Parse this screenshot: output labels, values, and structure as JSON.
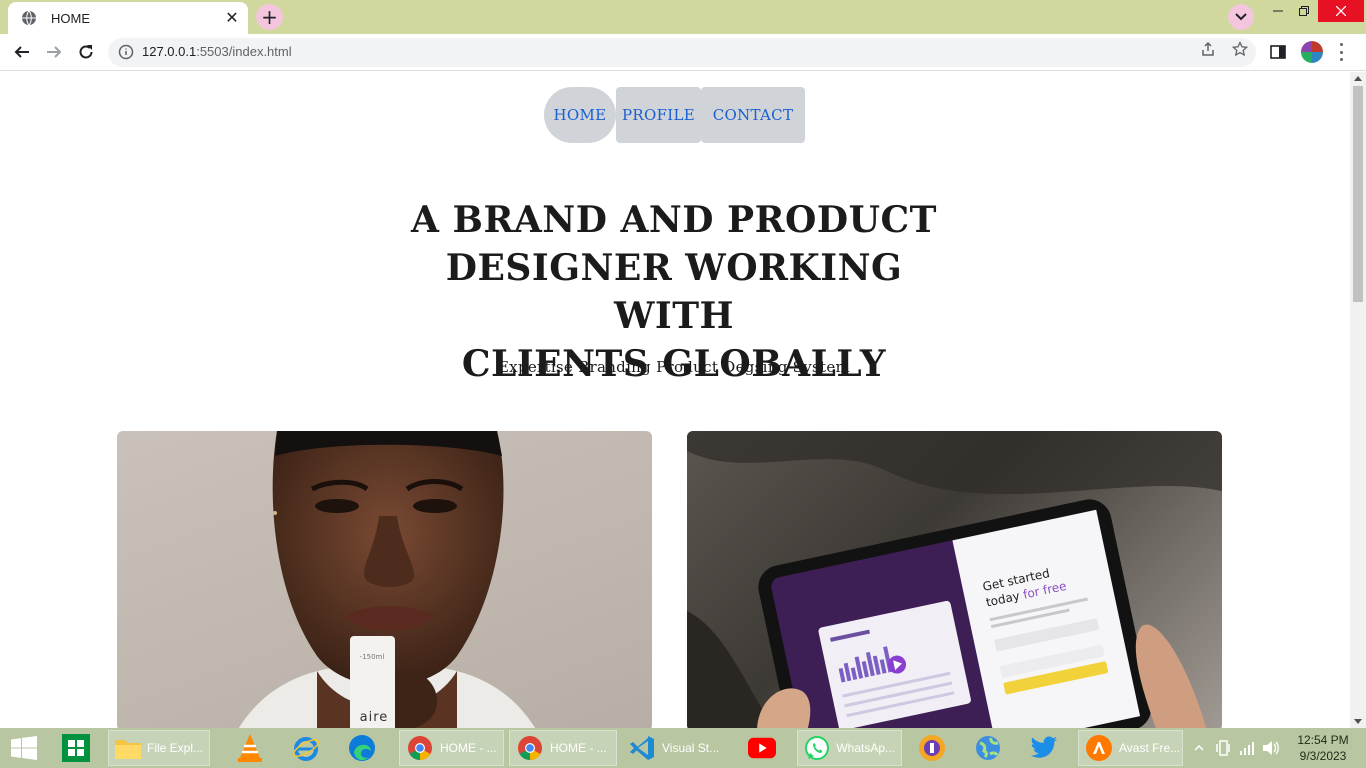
{
  "browser": {
    "tab_title": "HOME",
    "url_host": "127.0.0.1",
    "url_rest": ":5503/index.html"
  },
  "nav": {
    "home": "HOME",
    "profile": "PROFILE",
    "contact": "CONTACT",
    "link_color": "#1a5fd0",
    "bg_color": "#d0d4d9"
  },
  "hero": {
    "title_line1": "A BRAND AND PRODUCT",
    "title_line2": "DESIGNER WORKING WITH",
    "title_line3": "CLIENTS GLOBALLY",
    "subtitle": "Expertise Branding Product Degsing System"
  },
  "cards": [
    {
      "name": "portrait-photo",
      "icon": "photo-man-holding-product"
    },
    {
      "name": "tablet-photo",
      "icon": "photo-hands-holding-tablet"
    }
  ],
  "taskbar": {
    "items": [
      {
        "label": "File Expl...",
        "icon": "folder-icon"
      },
      {
        "label": "HOME - ...",
        "icon": "chrome-icon"
      },
      {
        "label": "HOME - ...",
        "icon": "chrome-icon"
      },
      {
        "label": "Visual St...",
        "icon": "vscode-icon"
      },
      {
        "label": "WhatsAp...",
        "icon": "whatsapp-icon"
      },
      {
        "label": "Avast Fre...",
        "icon": "avast-icon"
      }
    ],
    "time": "12:54 PM",
    "date": "9/3/2023"
  }
}
